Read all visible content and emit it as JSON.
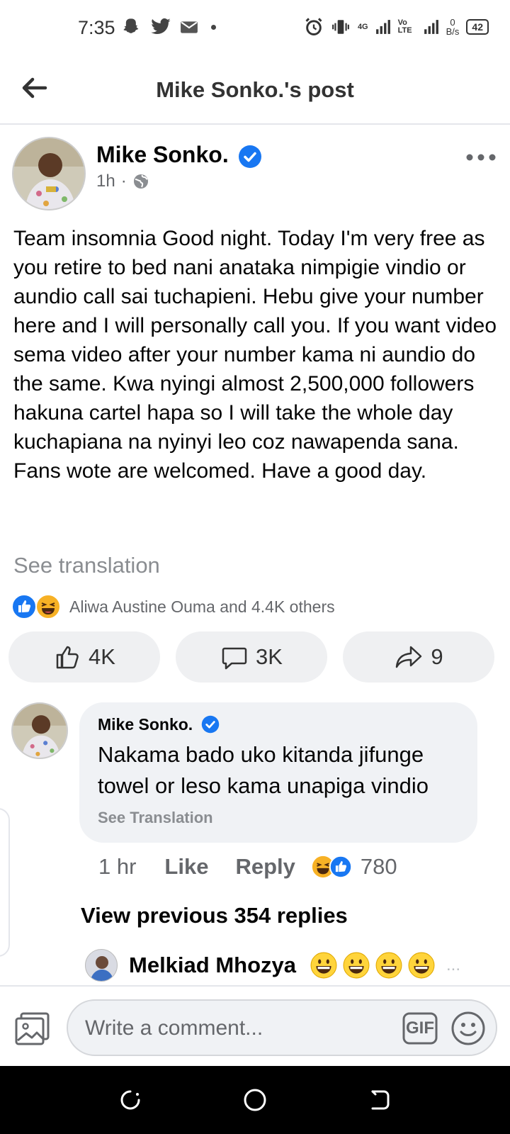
{
  "status_bar": {
    "time": "7:35",
    "network_label": "4G",
    "volte_label": "Vo LTE",
    "speed_value": "0",
    "speed_unit": "B/s",
    "battery": "42"
  },
  "header": {
    "title": "Mike Sonko.'s post",
    "back_icon": "back-arrow-icon"
  },
  "post": {
    "author": "Mike Sonko.",
    "time": "1h",
    "separator": "·",
    "verified": true,
    "text": "Team insomnia Good night. Today I'm very free as you retire to bed nani anataka nimpigie vindio or aundio call sai tuchapieni. Hebu give your number here and I will personally call you. If you want video sema video after your number kama ni aundio do the same. Kwa nyingi almost 2,500,000 followers hakuna cartel hapa so I will take the whole day kuchapiana na nyinyi leo coz nawapenda sana. Fans wote are welcomed. Have a good day.",
    "see_translation": "See translation",
    "reactions_text": "Aliwa Austine Ouma and 4.4K others"
  },
  "actions": {
    "like_count": "4K",
    "comment_count": "3K",
    "share_count": "9"
  },
  "comment": {
    "author": "Mike Sonko.",
    "text": "Nakama bado uko kitanda jifunge towel or leso kama unapiga vindio",
    "see_translation": "See Translation",
    "time": "1 hr",
    "like_label": "Like",
    "reply_label": "Reply",
    "reaction_count": "780",
    "view_previous": "View previous 354 replies"
  },
  "reply": {
    "author": "Melkiad Mhozya",
    "ellipsis": "..."
  },
  "composer": {
    "placeholder": "Write a comment...",
    "gif_label": "GIF"
  },
  "colors": {
    "brand_blue": "#1877f2",
    "text_primary": "#050505",
    "text_secondary": "#65676b",
    "bubble_bg": "#f0f2f5"
  }
}
